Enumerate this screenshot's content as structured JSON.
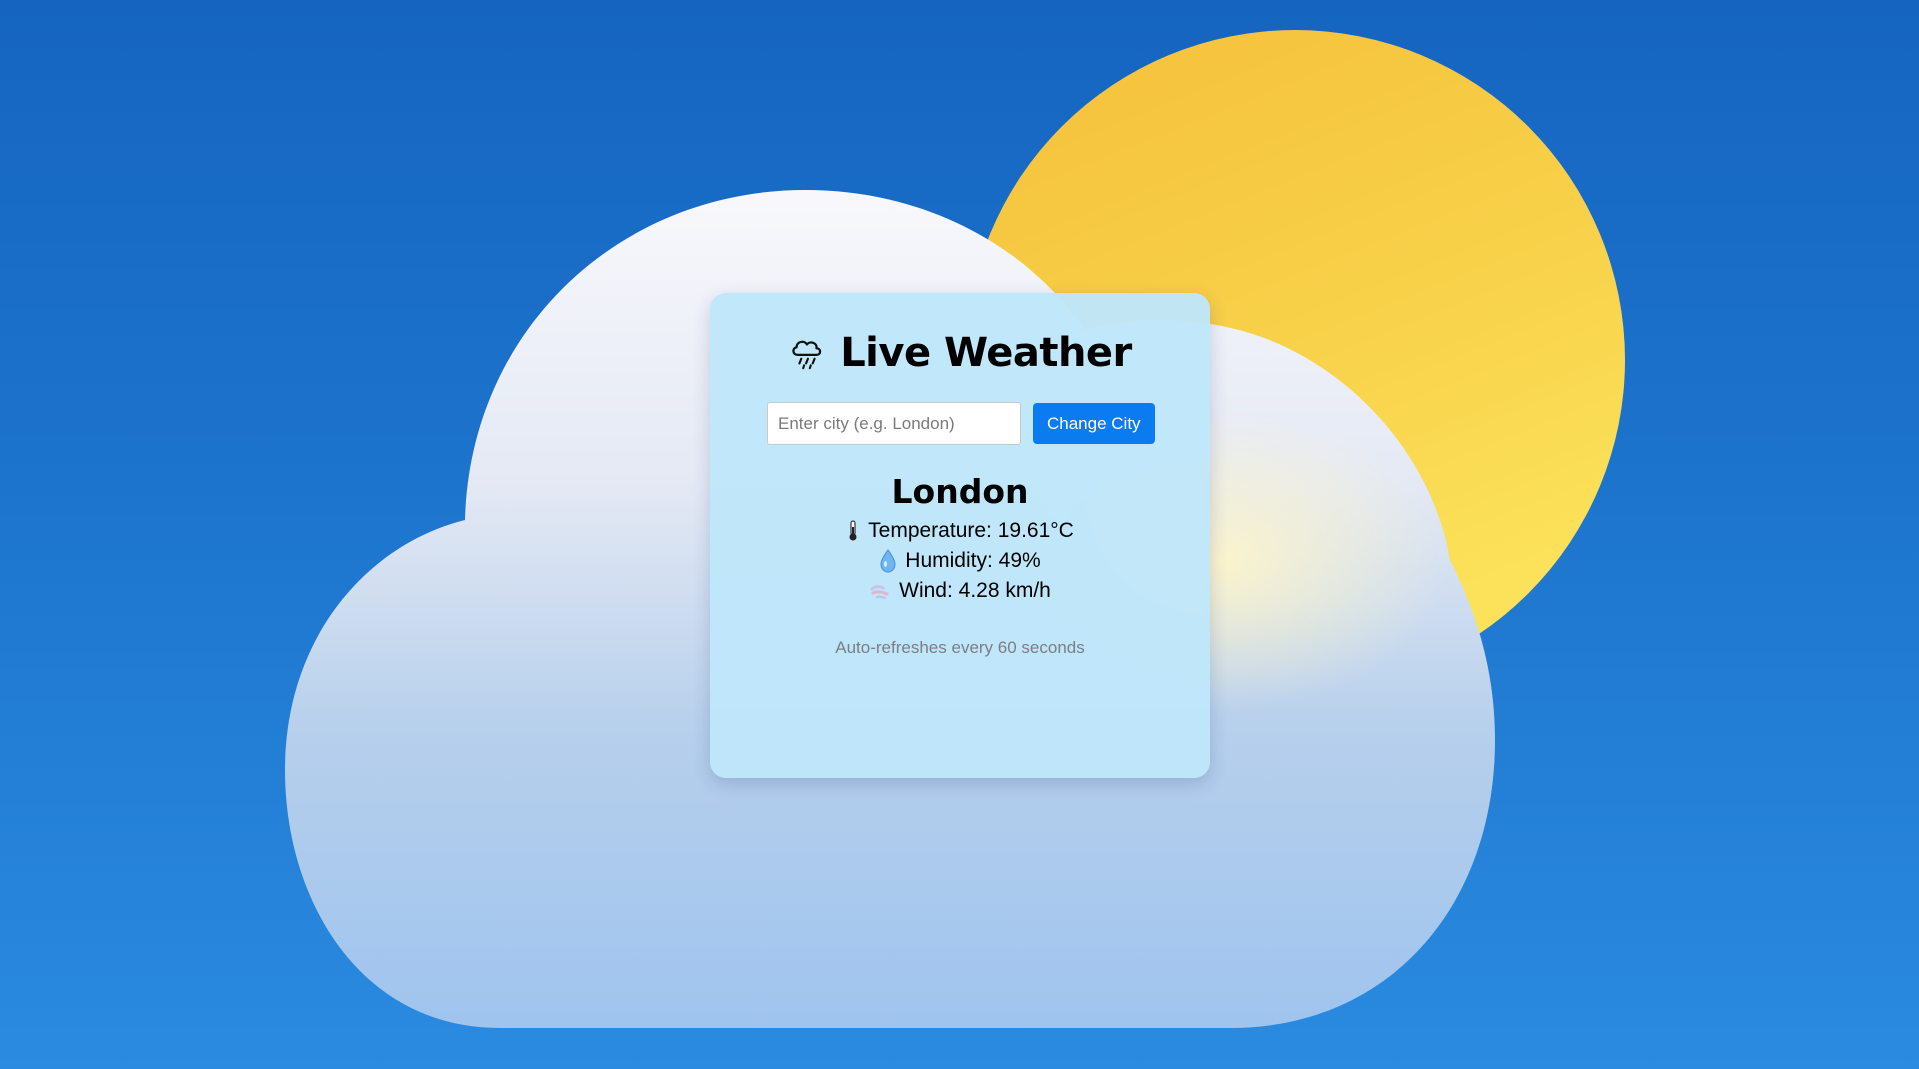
{
  "app": {
    "title": "Live Weather",
    "title_icon": "cloud-rain-icon"
  },
  "search": {
    "placeholder": "Enter city (e.g. London)",
    "value": "",
    "button_label": "Change City"
  },
  "weather": {
    "city": "London",
    "temperature": "Temperature: 19.61°C",
    "humidity": "Humidity: 49%",
    "wind": "Wind: 4.28 km/h",
    "temperature_icon": "thermometer-icon",
    "humidity_icon": "droplet-icon",
    "wind_icon": "wind-icon"
  },
  "note": "Auto-refreshes every 60 seconds",
  "colors": {
    "sky": "#1d74cc",
    "sun": "#f7c948",
    "card": "#bee6fa",
    "button": "#0b7cf0"
  }
}
